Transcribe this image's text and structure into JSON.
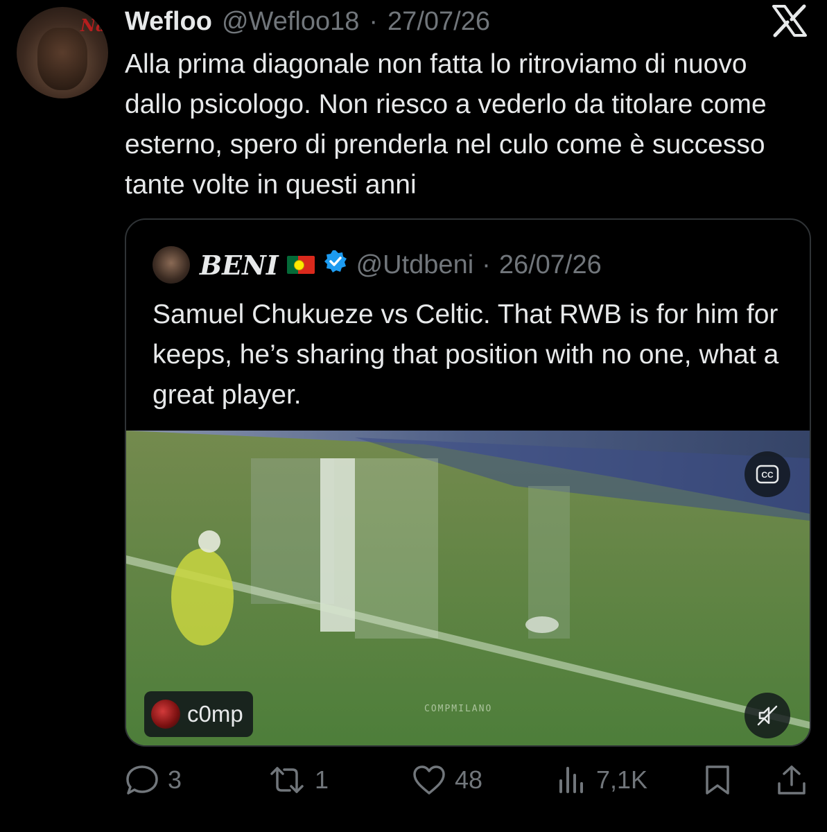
{
  "tweet": {
    "author_name": "Wefloo",
    "handle": "@Wefloo18",
    "separator": "·",
    "date": "27/07/26",
    "text": "Alla prima diagonale non fatta lo ritroviamo di nuovo dallo psicologo. Non riesco a vederlo da titolare come esterno, spero di prenderla nel culo come è successo tante volte in questi anni",
    "avatar_logo_text": "Nas"
  },
  "quoted_tweet": {
    "author_name": "BENI",
    "flag": "portugal-flag",
    "verified": true,
    "handle": "@Utdbeni",
    "separator": "·",
    "date": "26/07/26",
    "text": "Samuel Chukueze vs Celtic. That RWB is for him for keeps, he’s sharing that position with no one, what a great player.",
    "video": {
      "uploader_label": "c0mp",
      "watermark": "COMPMILANO",
      "captions_icon": "cc-icon",
      "mute_icon": "muted-speaker-icon"
    }
  },
  "actions": {
    "reply_count": "3",
    "retweet_count": "1",
    "like_count": "48",
    "views_count": "7,1K"
  },
  "colors": {
    "background": "#000000",
    "text_primary": "#e7e9ea",
    "text_secondary": "#71767b",
    "border": "#2f3336",
    "verified_blue": "#1d9bf0"
  }
}
